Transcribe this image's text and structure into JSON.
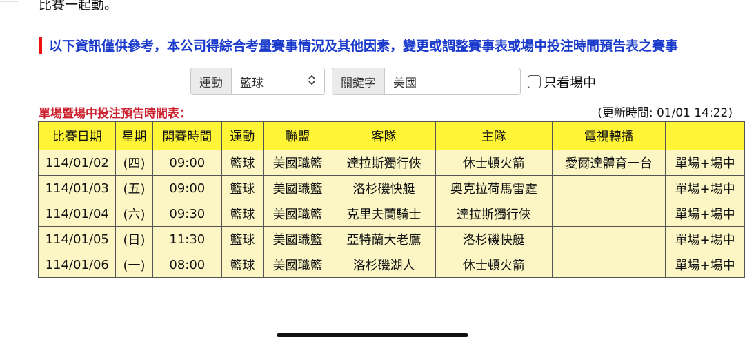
{
  "intro_text": "比賽一起動。",
  "notice": "以下資訊僅供參考，本公司得綜合考量賽事情況及其他因素，變更或調整賽事表或場中投注時間預告表之賽事",
  "filters": {
    "sport_label": "運動",
    "sport_value": "籃球",
    "keyword_label": "關鍵字",
    "keyword_value": "美國",
    "live_only_label": "只看場中"
  },
  "schedule": {
    "title": "單場暨場中投注預告時間表：",
    "updated": "(更新時間: 01/01 14:22)",
    "headers": [
      "比賽日期",
      "星期",
      "開賽時間",
      "運動",
      "聯盟",
      "客隊",
      "主隊",
      "電視轉播",
      ""
    ],
    "rows": [
      [
        "114/01/02",
        "(四)",
        "09:00",
        "籃球",
        "美國職籃",
        "達拉斯獨行俠",
        "休士頓火箭",
        "愛爾達體育一台",
        "單場+場中"
      ],
      [
        "114/01/03",
        "(五)",
        "09:00",
        "籃球",
        "美國職籃",
        "洛杉磯快艇",
        "奧克拉荷馬雷霆",
        "",
        "單場+場中"
      ],
      [
        "114/01/04",
        "(六)",
        "09:30",
        "籃球",
        "美國職籃",
        "克里夫蘭騎士",
        "達拉斯獨行俠",
        "",
        "單場+場中"
      ],
      [
        "114/01/05",
        "(日)",
        "11:30",
        "籃球",
        "美國職籃",
        "亞特蘭大老鷹",
        "洛杉磯快艇",
        "",
        "單場+場中"
      ],
      [
        "114/01/06",
        "(一)",
        "08:00",
        "籃球",
        "美國職籃",
        "洛杉磯湖人",
        "休士頓火箭",
        "",
        "單場+場中"
      ]
    ]
  },
  "colors": {
    "notice_bar": "#ee1111",
    "notice_text": "#1a3acc",
    "title_red": "#cc1f2d",
    "header_yellow": "#fff536",
    "cell_yellow": "#fbf6c4"
  }
}
